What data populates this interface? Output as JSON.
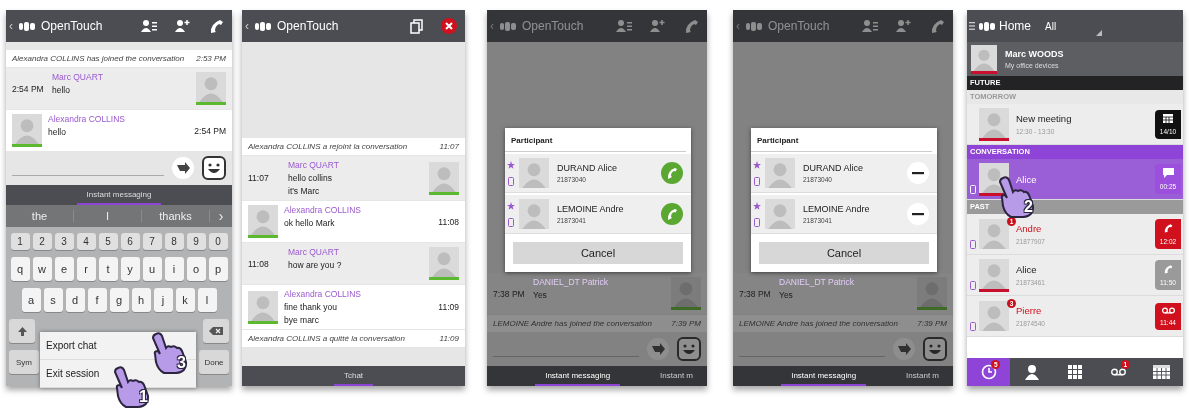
{
  "chat_screens": [
    {
      "kind": "keyboard",
      "header": {
        "kind": "chat",
        "back": "‹",
        "title": "OpenTouch"
      },
      "messages": [
        {
          "kind": "system",
          "text": "Alexandra COLLINS has joined the conversation",
          "time": "2:53 PM"
        },
        {
          "kind": "remote",
          "sender": "Marc QUART",
          "lines": [
            "hello"
          ],
          "time": "2:54 PM"
        },
        {
          "kind": "local",
          "sender": "Alexandra COLLINS",
          "lines": [
            "hello"
          ],
          "time": "2:54 PM"
        }
      ],
      "tabs": [
        {
          "label": "Instant messaging",
          "selected": true
        }
      ],
      "suggestions": [
        "the",
        "I",
        "thanks"
      ],
      "suggestion_more": "›",
      "keyboard": {
        "rows": [
          [
            "1",
            "2",
            "3",
            "4",
            "5",
            "6",
            "7",
            "8",
            "9",
            "0"
          ],
          [
            "q",
            "w",
            "e",
            "r",
            "t",
            "y",
            "u",
            "i",
            "o",
            "p"
          ],
          [
            "a",
            "s",
            "d",
            "f",
            "g",
            "h",
            "j",
            "k",
            "l"
          ]
        ],
        "sym": "Sym",
        "done": "Done"
      },
      "menu": [
        {
          "label": "Export chat",
          "step": "3"
        },
        {
          "label": "Exit session",
          "step": "1"
        }
      ]
    },
    {
      "kind": "transcript",
      "header": {
        "kind": "transcript",
        "back": "‹",
        "title": "OpenTouch"
      },
      "messages": [
        {
          "kind": "system",
          "text": "Alexandra COLLINS a rejoint la conversation",
          "time": "11:07"
        },
        {
          "kind": "remote",
          "sender": "Marc QUART",
          "lines": [
            "hello collins",
            "it's Marc"
          ],
          "time": "11:07"
        },
        {
          "kind": "local",
          "sender": "Alexandra COLLINS",
          "lines": [
            "ok hello Mark"
          ],
          "time": "11:08"
        },
        {
          "kind": "remote",
          "sender": "Marc QUART",
          "lines": [
            "how are you ?"
          ],
          "time": "11:08"
        },
        {
          "kind": "local",
          "sender": "Alexandra COLLINS",
          "lines": [
            "fine thank you",
            "bye marc"
          ],
          "time": "11:09"
        },
        {
          "kind": "system",
          "text": "Alexandra COLLINS a quitté la conversation",
          "time": "11:09"
        }
      ],
      "tabs": [
        {
          "label": "Tchat",
          "selected": true
        }
      ]
    },
    {
      "kind": "dialog",
      "header": {
        "kind": "chat",
        "back": "‹",
        "title": "OpenTouch"
      },
      "messages": [
        {
          "kind": "remote",
          "sender": "DANIEL_DT Patrick",
          "lines": [
            "Yes"
          ],
          "time": "7:38 PM"
        },
        {
          "kind": "system",
          "text": "LEMOINE Andre has joined the conversation",
          "time": "7:39 PM"
        }
      ],
      "tabs": [
        {
          "label": "Instant messaging",
          "selected": true
        },
        {
          "label": "Instant m",
          "selected": false
        }
      ],
      "dialog": {
        "title": "Participant",
        "kind": "call",
        "cancel": "Cancel",
        "participants": [
          {
            "name": "DURAND Alice",
            "number": "21873040",
            "favorite": true,
            "device": true
          },
          {
            "name": "LEMOINE Andre",
            "number": "21873041",
            "favorite": true,
            "device": true
          }
        ]
      }
    },
    {
      "kind": "dialog",
      "header": {
        "kind": "chat",
        "back": "‹",
        "title": "OpenTouch"
      },
      "messages": [
        {
          "kind": "remote",
          "sender": "DANIEL_DT Patrick",
          "lines": [
            "Yes"
          ],
          "time": "7:38 PM"
        },
        {
          "kind": "system",
          "text": "LEMOINE Andre has joined the conversation",
          "time": "7:39 PM"
        }
      ],
      "tabs": [
        {
          "label": "Instant messaging",
          "selected": true
        },
        {
          "label": "Instant m",
          "selected": false
        }
      ],
      "dialog": {
        "title": "Participant",
        "kind": "remove",
        "cancel": "Cancel",
        "participants": [
          {
            "name": "DURAND Alice",
            "number": "21873040",
            "favorite": true,
            "device": true
          },
          {
            "name": "LEMOINE Andre",
            "number": "21873041",
            "favorite": true,
            "device": true
          }
        ]
      }
    }
  ],
  "home_screen": {
    "header": {
      "title": "Home",
      "filter": "All"
    },
    "profile": {
      "name": "Marc WOODS",
      "subtitle": "My office devices",
      "presence": true
    },
    "sections": [
      {
        "title": "FUTURE",
        "kind": "future"
      },
      {
        "title": "TOMORROW",
        "kind": "day",
        "items": [
          {
            "name": "New meeting",
            "detail": "12:30 - 13:30",
            "missed": false,
            "selected": false,
            "device": false,
            "presence": true,
            "badge": {
              "kind": "calendar",
              "label": "14/10",
              "color": "#111111"
            }
          }
        ]
      },
      {
        "title": "CONVERSATION",
        "kind": "conversation",
        "items": [
          {
            "name": "Alice",
            "missed": false,
            "selected": true,
            "device": true,
            "presence": true,
            "step": "2",
            "badge": {
              "kind": "chat",
              "label": "00:25",
              "color": "#9b4fdc"
            }
          }
        ]
      },
      {
        "title": "PAST",
        "kind": "past",
        "items": [
          {
            "name": "Andre",
            "detail": "21877907",
            "missed": true,
            "selected": false,
            "device": true,
            "presence": false,
            "count": "1",
            "badge": {
              "kind": "call",
              "label": "12:02",
              "color": "#d0101c"
            }
          },
          {
            "name": "Alice",
            "detail": "21873461",
            "missed": false,
            "selected": false,
            "device": true,
            "presence": true,
            "badge": {
              "kind": "call",
              "label": "11:50",
              "color": "#9a9a9a"
            }
          },
          {
            "name": "Pierre",
            "detail": "21874540",
            "missed": true,
            "selected": false,
            "device": true,
            "presence": false,
            "count": "3",
            "badge": {
              "kind": "voicemail",
              "label": "11:44",
              "color": "#d0101c"
            }
          }
        ]
      }
    ],
    "nav": [
      {
        "kind": "history",
        "selected": true,
        "count": "5"
      },
      {
        "kind": "contacts",
        "selected": false
      },
      {
        "kind": "dialpad",
        "selected": false
      },
      {
        "kind": "voicemail",
        "selected": false,
        "count": "1"
      },
      {
        "kind": "calendar",
        "selected": false
      }
    ]
  }
}
